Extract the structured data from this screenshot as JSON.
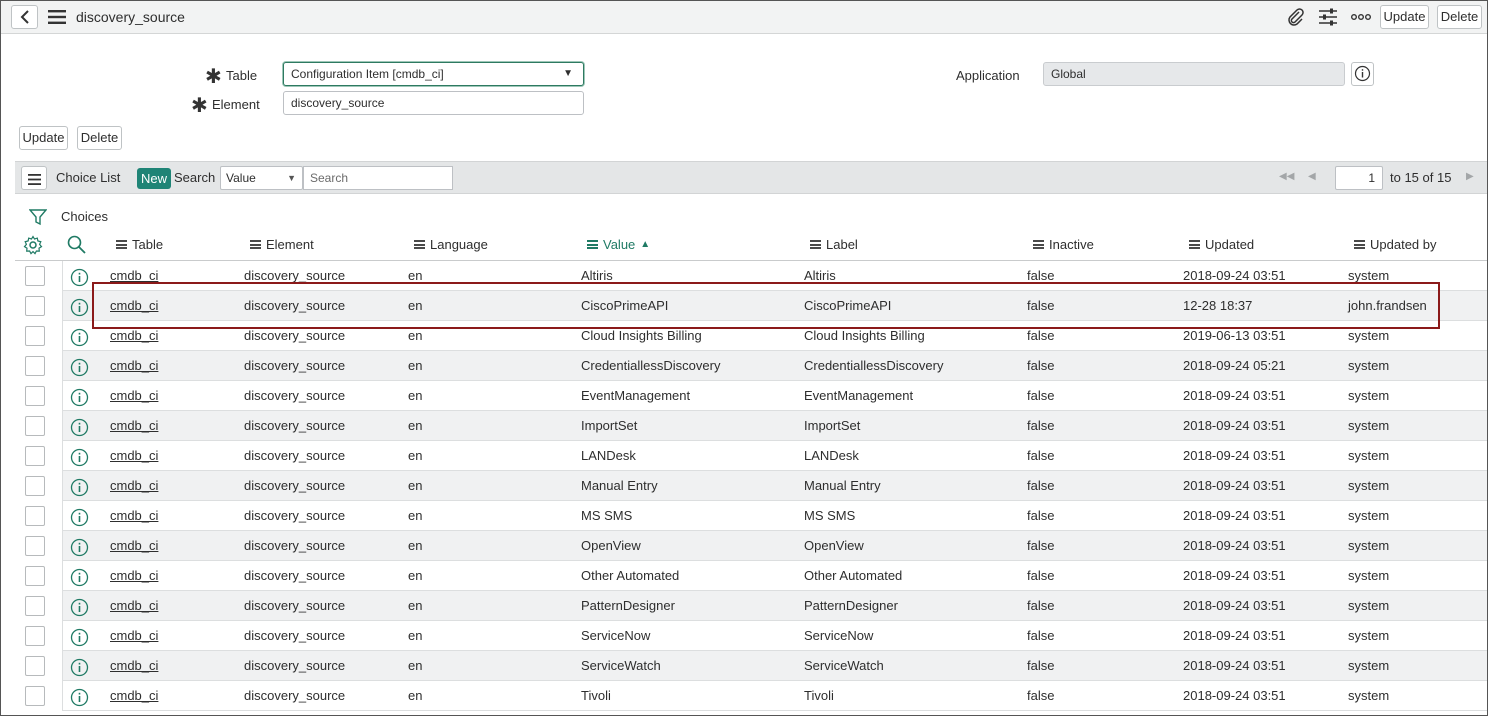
{
  "header": {
    "title": "discovery_source",
    "update_label": "Update",
    "delete_label": "Delete"
  },
  "form": {
    "table_label": "Table",
    "table_value": "Configuration Item [cmdb_ci]",
    "element_label": "Element",
    "element_value": "discovery_source",
    "application_label": "Application",
    "application_value": "Global",
    "update_label": "Update",
    "delete_label": "Delete"
  },
  "listbar": {
    "title": "Choice List",
    "new_label": "New",
    "search_label": "Search",
    "search_field": "Value",
    "search_placeholder": "Search",
    "page": "1",
    "range": "to 15 of 15"
  },
  "breadcrumb": {
    "label": "Choices"
  },
  "columns": [
    "Table",
    "Element",
    "Language",
    "Value",
    "Label",
    "Inactive",
    "Updated",
    "Updated by"
  ],
  "rows": [
    {
      "table": "cmdb_ci",
      "element": "discovery_source",
      "language": "en",
      "value": "Altiris",
      "label": "Altiris",
      "inactive": "false",
      "updated": "2018-09-24 03:51",
      "updated_by": "system"
    },
    {
      "table": "cmdb_ci",
      "element": "discovery_source",
      "language": "en",
      "value": "CiscoPrimeAPI",
      "label": "CiscoPrimeAPI",
      "inactive": "false",
      "updated": "12-28 18:37",
      "updated_by": "john.frandsen"
    },
    {
      "table": "cmdb_ci",
      "element": "discovery_source",
      "language": "en",
      "value": "Cloud Insights Billing",
      "label": "Cloud Insights Billing",
      "inactive": "false",
      "updated": "2019-06-13 03:51",
      "updated_by": "system"
    },
    {
      "table": "cmdb_ci",
      "element": "discovery_source",
      "language": "en",
      "value": "CredentiallessDiscovery",
      "label": "CredentiallessDiscovery",
      "inactive": "false",
      "updated": "2018-09-24 05:21",
      "updated_by": "system"
    },
    {
      "table": "cmdb_ci",
      "element": "discovery_source",
      "language": "en",
      "value": "EventManagement",
      "label": "EventManagement",
      "inactive": "false",
      "updated": "2018-09-24 03:51",
      "updated_by": "system"
    },
    {
      "table": "cmdb_ci",
      "element": "discovery_source",
      "language": "en",
      "value": "ImportSet",
      "label": "ImportSet",
      "inactive": "false",
      "updated": "2018-09-24 03:51",
      "updated_by": "system"
    },
    {
      "table": "cmdb_ci",
      "element": "discovery_source",
      "language": "en",
      "value": "LANDesk",
      "label": "LANDesk",
      "inactive": "false",
      "updated": "2018-09-24 03:51",
      "updated_by": "system"
    },
    {
      "table": "cmdb_ci",
      "element": "discovery_source",
      "language": "en",
      "value": "Manual Entry",
      "label": "Manual Entry",
      "inactive": "false",
      "updated": "2018-09-24 03:51",
      "updated_by": "system"
    },
    {
      "table": "cmdb_ci",
      "element": "discovery_source",
      "language": "en",
      "value": "MS SMS",
      "label": "MS SMS",
      "inactive": "false",
      "updated": "2018-09-24 03:51",
      "updated_by": "system"
    },
    {
      "table": "cmdb_ci",
      "element": "discovery_source",
      "language": "en",
      "value": "OpenView",
      "label": "OpenView",
      "inactive": "false",
      "updated": "2018-09-24 03:51",
      "updated_by": "system"
    },
    {
      "table": "cmdb_ci",
      "element": "discovery_source",
      "language": "en",
      "value": "Other Automated",
      "label": "Other Automated",
      "inactive": "false",
      "updated": "2018-09-24 03:51",
      "updated_by": "system"
    },
    {
      "table": "cmdb_ci",
      "element": "discovery_source",
      "language": "en",
      "value": "PatternDesigner",
      "label": "PatternDesigner",
      "inactive": "false",
      "updated": "2018-09-24 03:51",
      "updated_by": "system"
    },
    {
      "table": "cmdb_ci",
      "element": "discovery_source",
      "language": "en",
      "value": "ServiceNow",
      "label": "ServiceNow",
      "inactive": "false",
      "updated": "2018-09-24 03:51",
      "updated_by": "system"
    },
    {
      "table": "cmdb_ci",
      "element": "discovery_source",
      "language": "en",
      "value": "ServiceWatch",
      "label": "ServiceWatch",
      "inactive": "false",
      "updated": "2018-09-24 03:51",
      "updated_by": "system"
    },
    {
      "table": "cmdb_ci",
      "element": "discovery_source",
      "language": "en",
      "value": "Tivoli",
      "label": "Tivoli",
      "inactive": "false",
      "updated": "2018-09-24 03:51",
      "updated_by": "system"
    }
  ],
  "highlighted_row": 1,
  "colors": {
    "accent": "#1f8476",
    "sorted": "#1f7a64",
    "highlight": "#8b1a1a"
  },
  "icons": [
    "back-icon",
    "menu-icon",
    "paperclip-icon",
    "settings-sliders-icon",
    "more-icon",
    "info-icon",
    "filter-icon",
    "gear-icon",
    "search-icon",
    "sort-ascending-icon"
  ]
}
